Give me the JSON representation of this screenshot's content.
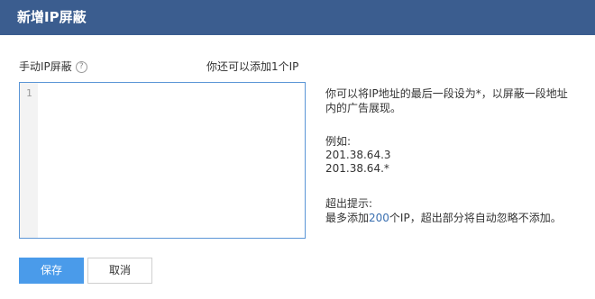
{
  "dialog": {
    "title": "新增IP屏蔽"
  },
  "form": {
    "label": "手动IP屏蔽",
    "help_icon": "?",
    "remaining_text": "你还可以添加1个IP",
    "editor_line_number": "1",
    "editor_value": ""
  },
  "help": {
    "description": "你可以将IP地址的最后一段设为*，以屏蔽一段地址内的广告展现。",
    "example_title": "例如:",
    "example_1": "201.38.64.3",
    "example_2": "201.38.64.*",
    "tip_title": "超出提示:",
    "tip_prefix": "最多添加",
    "tip_number": "200",
    "tip_suffix": "个IP，超出部分将自动忽略不添加。"
  },
  "buttons": {
    "save_label": "保存",
    "cancel_label": "取消"
  },
  "colors": {
    "titlebar": "#3b5d8f",
    "primary": "#4a9bea",
    "highlight": "#3a6fb0"
  }
}
